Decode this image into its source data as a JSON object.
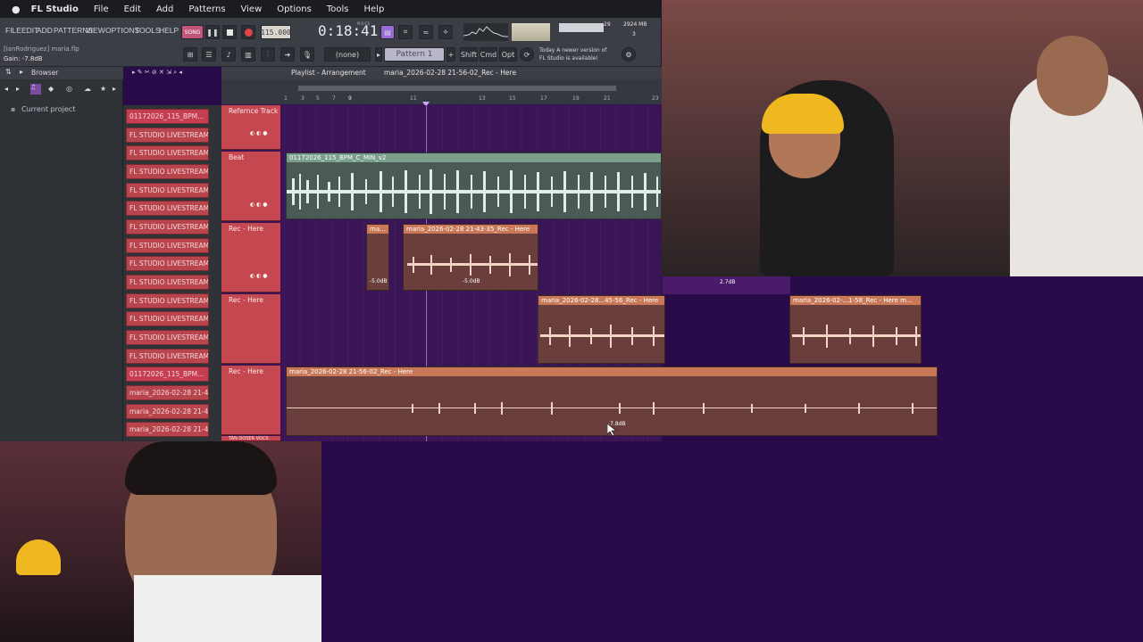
{
  "mac_menu": {
    "app": "FL Studio",
    "items": [
      "File",
      "Edit",
      "Add",
      "Patterns",
      "View",
      "Options",
      "Tools",
      "Help"
    ]
  },
  "fl_menu": [
    "FILE",
    "EDIT",
    "ADD",
    "PATTERNS",
    "VIEW",
    "OPTIONS",
    "TOOLS",
    "HELP"
  ],
  "hint": {
    "user": "[IanRodriguez] maria.flp",
    "gain": "Gain: -7.8dB"
  },
  "transport": {
    "song_mode": "SONG",
    "tempo": "115.000",
    "time": "0:18:41",
    "time_unit": "M:S:CS",
    "pattern": "Pattern 1",
    "snap": "(none)",
    "cpu": "29",
    "ram": "2924 MB",
    "voices": "3"
  },
  "mod_keys": [
    "Shift",
    "Cmd",
    "Opt"
  ],
  "news": {
    "line1": "Today  A newer version of",
    "line2": "FL Studio is available!"
  },
  "browser": {
    "title": "Browser",
    "item": "Current project"
  },
  "playlist": {
    "title": "Playlist - Arrangement",
    "crumb": "maria_2026-02-28 21-56-02_Rec - Here"
  },
  "ruler": [
    "1",
    "3",
    "5",
    "7",
    "9",
    "11",
    "13",
    "15",
    "17",
    "19",
    "21",
    "23"
  ],
  "channels": [
    "01172026_115_BPM...",
    "FL STUDIO LIVESTREAM T...",
    "FL STUDIO LIVESTREAM T...",
    "FL STUDIO LIVESTREAM T...",
    "FL STUDIO LIVESTREAM T...",
    "FL STUDIO LIVESTREAM T...",
    "FL STUDIO LIVESTREAM T...",
    "FL STUDIO LIVESTREAM T...",
    "FL STUDIO LIVESTREAM T...",
    "FL STUDIO LIVESTREAM T...",
    "FL STUDIO LIVESTREAM T...",
    "FL STUDIO LIVESTREAM T...",
    "FL STUDIO LIVESTREAM T...",
    "FL STUDIO LIVESTREAM T...",
    "01172026_115_BPM...",
    "maria_2026-02-28 21-4...",
    "maria_2026-02-28 21-4...",
    "maria_2026-02-28 21-4..."
  ],
  "tracks": [
    "Refernce Track",
    "Beat",
    "Rec - Here",
    "Rec - Here",
    "Rec - Here",
    "TAN DOSER VOCS"
  ],
  "clips": {
    "beat": "01172026_115_BPM_C_MIN_v2",
    "rec1a": "ma...",
    "rec1b": "maria_2026-02-28 21-43-35_Rec - Here",
    "rec2a": "maria_2026-02-28...45-56_Rec - Here",
    "rec2b": "maria_2026-02-...1-58_Rec - Here",
    "rec2c": "m...",
    "rec3": "maria_2026-02-28 21-56-02_Rec - Here"
  },
  "gains": {
    "g1": "-5.0dB",
    "g2": "-5.0dB",
    "g3": "2.7dB",
    "g4": "-7.8dB"
  },
  "colors": {
    "accent": "#c5474f",
    "clip_green": "#7aa08c",
    "clip_peach": "#c97958",
    "bg_purple": "#2a0b4a"
  }
}
